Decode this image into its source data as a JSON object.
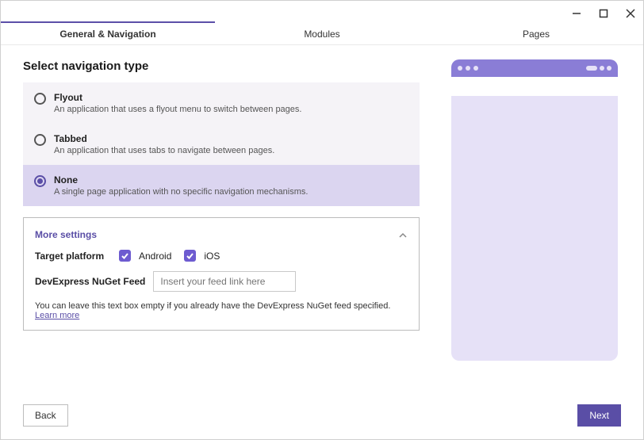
{
  "window": {
    "minimize": "−",
    "maximize": "□",
    "close": "×"
  },
  "tabs": [
    "General & Navigation",
    "Modules",
    "Pages"
  ],
  "activeTab": 0,
  "heading": "Select navigation type",
  "options": [
    {
      "title": "Flyout",
      "desc": "An application that uses a flyout menu to switch between pages."
    },
    {
      "title": "Tabbed",
      "desc": "An application that uses tabs to navigate between pages."
    },
    {
      "title": "None",
      "desc": "A single page application with no specific navigation mechanisms."
    }
  ],
  "selectedOption": 2,
  "more": {
    "header": "More settings",
    "targetPlatformLabel": "Target platform",
    "platforms": [
      {
        "label": "Android",
        "checked": true
      },
      {
        "label": "iOS",
        "checked": true
      }
    ],
    "feedLabel": "DevExpress NuGet Feed",
    "feedPlaceholder": "Insert your feed link here",
    "hint": "You can leave this text box empty if you already have the DevExpress NuGet feed specified. ",
    "learnMore": "Learn more"
  },
  "buttons": {
    "back": "Back",
    "next": "Next"
  },
  "colors": {
    "accent": "#5a4ea6",
    "accentLight": "#8a7dd6",
    "previewBg": "#e6e1f7",
    "selectedBg": "#dbd5f0"
  }
}
